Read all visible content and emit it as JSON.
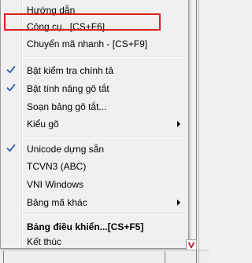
{
  "menu": {
    "items": [
      {
        "label": "Hướng dẫn"
      },
      {
        "label": "Công cụ...[CS+F6]"
      },
      {
        "label": "Chuyển mã nhanh - [CS+F9]"
      },
      {
        "label": "Bật kiểm tra chính tả",
        "checked": true
      },
      {
        "label": "Bật tính năng gõ tắt",
        "checked": true
      },
      {
        "label": "Soạn bảng gõ tắt..."
      },
      {
        "label": "Kiểu gõ",
        "submenu": true
      },
      {
        "label": "Unicode dựng sẵn",
        "checked": true
      },
      {
        "label": "TCVN3 (ABC)"
      },
      {
        "label": "VNI Windows"
      },
      {
        "label": "Bảng mã khác",
        "submenu": true
      },
      {
        "label": "Bảng điều khiển...[CS+F5]",
        "bold": true
      },
      {
        "label": "Kết thúc"
      }
    ]
  },
  "colors": {
    "check": "#2a5fb5",
    "highlight": "#d9201f",
    "tray_icon": "#c8102e"
  },
  "icons": {
    "check": "checkmark-icon",
    "submenu": "chevron-right-icon",
    "tray": "unikey-tray-icon"
  }
}
